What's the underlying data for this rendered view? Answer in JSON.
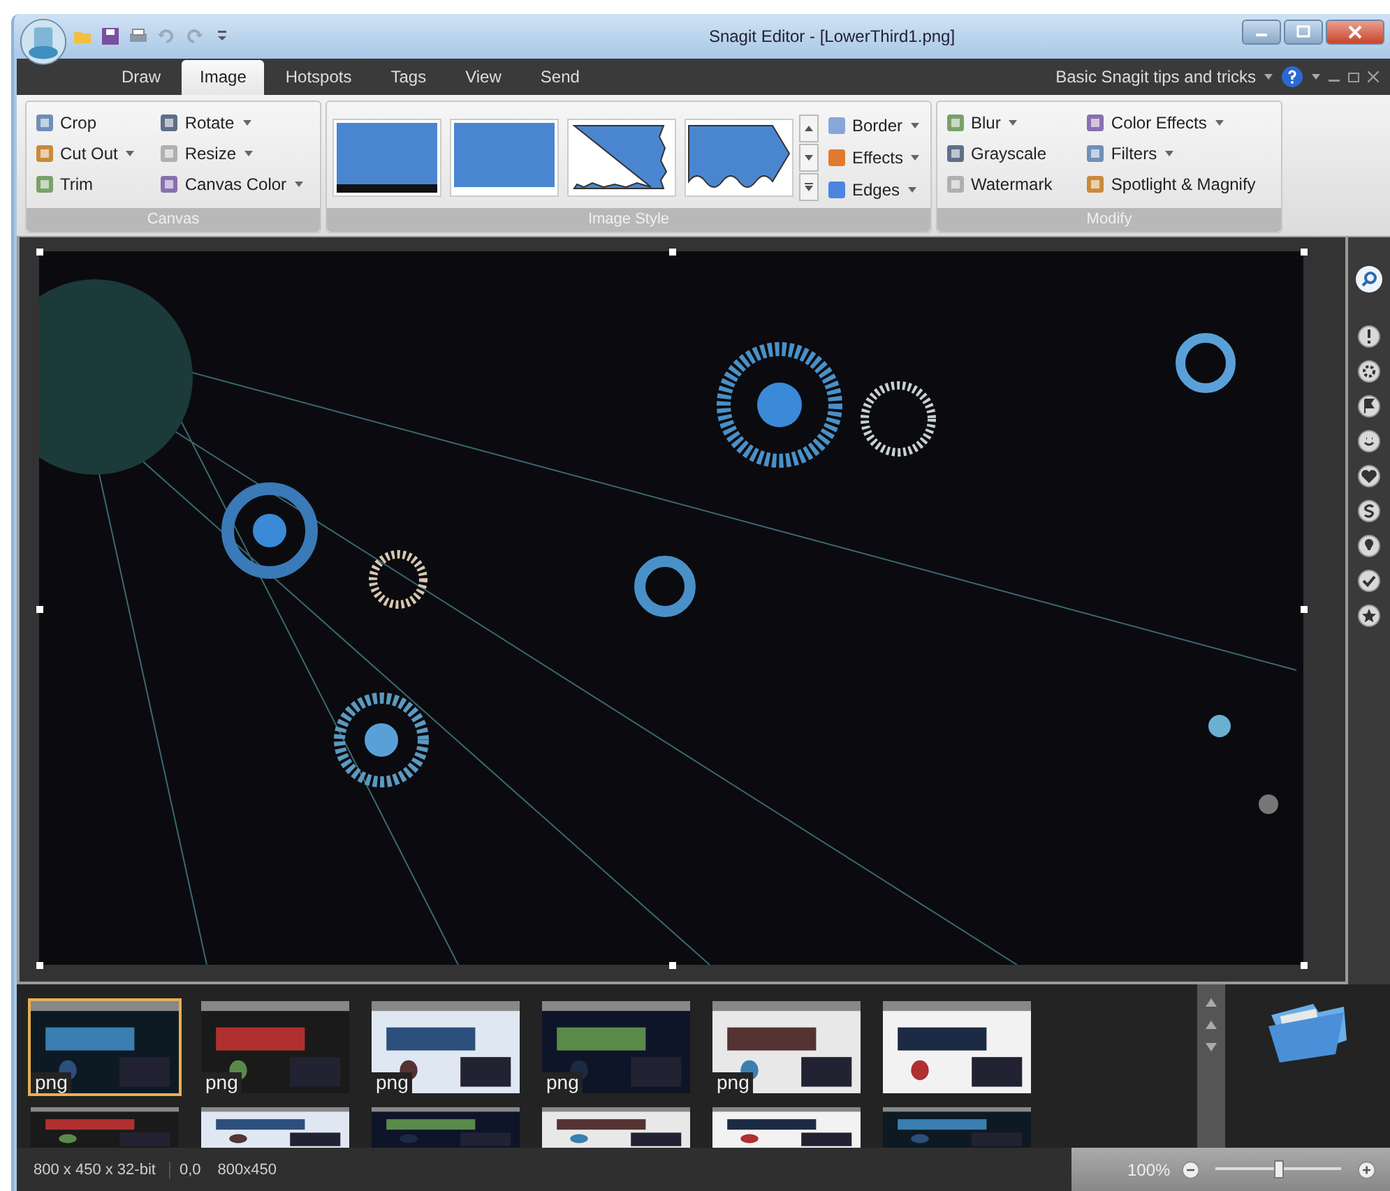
{
  "window": {
    "title": "Snagit Editor - [LowerThird1.png]"
  },
  "tabs": [
    {
      "label": "Draw",
      "selected": false
    },
    {
      "label": "Image",
      "selected": true
    },
    {
      "label": "Hotspots",
      "selected": false
    },
    {
      "label": "Tags",
      "selected": false
    },
    {
      "label": "View",
      "selected": false
    },
    {
      "label": "Send",
      "selected": false
    }
  ],
  "help_link": {
    "label": "Basic Snagit tips and tricks"
  },
  "ribbon": {
    "groups": [
      {
        "kind": "buttons",
        "label": "Canvas",
        "buttons": [
          {
            "label": "Crop",
            "dropdown": false
          },
          {
            "label": "Cut Out",
            "dropdown": true
          },
          {
            "label": "Trim",
            "dropdown": false
          },
          {
            "label": "Rotate",
            "dropdown": true
          },
          {
            "label": "Resize",
            "dropdown": true
          },
          {
            "label": "Canvas Color",
            "dropdown": true
          }
        ]
      },
      {
        "kind": "gallery",
        "label": "Image Style",
        "styles": [
          {
            "kind": "bar"
          },
          {
            "kind": "plain"
          },
          {
            "kind": "torn"
          },
          {
            "kind": "wave"
          }
        ],
        "buttons": [
          {
            "label": "Border",
            "dropdown": true
          },
          {
            "label": "Effects",
            "dropdown": true
          },
          {
            "label": "Edges",
            "dropdown": true
          }
        ]
      },
      {
        "kind": "buttons",
        "label": "Modify",
        "buttons": [
          {
            "label": "Blur",
            "dropdown": true
          },
          {
            "label": "Grayscale",
            "dropdown": false
          },
          {
            "label": "Watermark",
            "dropdown": false
          },
          {
            "label": "Color Effects",
            "dropdown": true
          },
          {
            "label": "Filters",
            "dropdown": true
          },
          {
            "label": "Spotlight & Magnify",
            "dropdown": false
          }
        ]
      }
    ]
  },
  "tray": {
    "rows": [
      [
        {
          "label": "png",
          "selected": true
        },
        {
          "label": "png",
          "selected": false
        },
        {
          "label": "png",
          "selected": false
        },
        {
          "label": "png",
          "selected": false
        },
        {
          "label": "png",
          "selected": false
        },
        {
          "selected": false
        }
      ],
      [
        {
          "selected": false
        },
        {
          "selected": false
        },
        {
          "selected": false
        },
        {
          "selected": false
        },
        {
          "selected": false
        },
        {
          "selected": false
        }
      ]
    ]
  },
  "status_bar": {
    "items": [
      "800 x 450 x 32-bit",
      "0,0",
      "800x450"
    ]
  },
  "zoom": {
    "reading": "100%",
    "level": 0.5
  }
}
